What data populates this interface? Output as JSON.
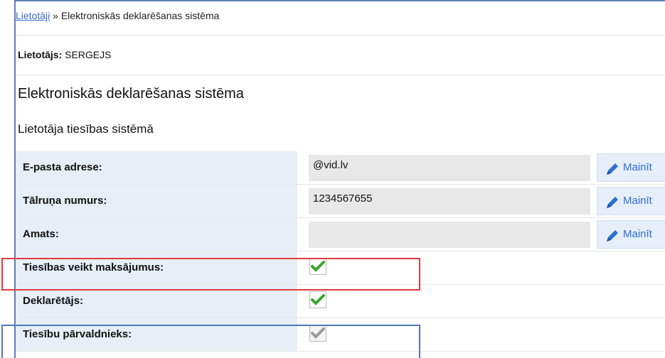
{
  "breadcrumb": {
    "link": "Lietotāji",
    "separator": " » ",
    "current": "Elektroniskās deklarēšanas sistēma"
  },
  "user": {
    "label": "Lietotājs:",
    "name": " SERGEJS"
  },
  "page_title": "Elektroniskās deklarēšanas sistēma",
  "section_title": "Lietotāja tiesības sistēmā",
  "fields": [
    {
      "label": "E-pasta adrese:",
      "value": "@vid.lv",
      "action": "Mainīt"
    },
    {
      "label": "Tālruņa numurs:",
      "value": "1234567655",
      "action": "Mainīt"
    },
    {
      "label": "Amats:",
      "value": "",
      "action": "Mainīt"
    }
  ],
  "rights": [
    {
      "label": "Tiesības veikt maksājumus:",
      "checked": true,
      "enabled": true
    },
    {
      "label": "Deklarētājs:",
      "checked": true,
      "enabled": true
    },
    {
      "label": "Tiesību pārvaldnieks:",
      "checked": true,
      "enabled": false
    }
  ],
  "colors": {
    "check_active": "#3aa62a",
    "check_disabled": "#9a9a9a",
    "highlight_red": "#e03a3a",
    "highlight_blue": "#4e79b9",
    "link": "#3a6ec9"
  },
  "icons": [
    "pencil-icon",
    "checkmark-icon"
  ]
}
